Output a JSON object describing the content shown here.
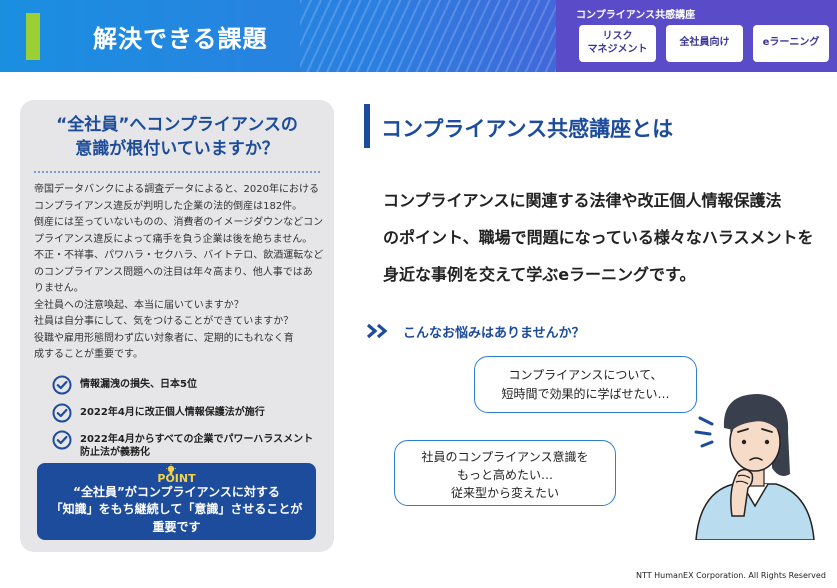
{
  "header": {
    "title": "解決できる課題",
    "course_title": "コンプライアンス共感講座",
    "tags": [
      "リスク\nマネジメント",
      "全社員向け",
      "eラーニング"
    ]
  },
  "left": {
    "heading": [
      "“全社員”へコンプライアンスの",
      "意識が根付いていますか？"
    ],
    "body": [
      "帝国データバンクによる調査データによると、2020年における",
      "コンプライアンス違反が判明した企業の法的倒産は182件。",
      "倒産には至っていないものの、消費者のイメージダウンなどコン",
      "プライアンス違反によって痛手を負う企業は後を絶ちません。",
      "不正・不祥事、パワハラ・セクハラ、バイトテロ、飲酒運転など",
      "のコンプライアンス問題への注目は年々高まり、他人事ではあ",
      "りません。",
      "全社員への注意喚起、本当に届いていますか？",
      "社員は自分事にして、気をつけることができていますか？",
      "役職や雇用形態問わず広い対象者に、定期的にもれなく育",
      "成することが重要です。"
    ],
    "checks": [
      "情報漏洩の損失、日本5位",
      "2022年4月に改正個人情報保護法が施行",
      "2022年4月からすべての企業でパワーハラスメント\n防止法が義務化"
    ],
    "point_label": "POINT",
    "point_text": [
      "“全社員”がコンプライアンスに対する",
      "「知識」をもち継続して「意識」させることが",
      "重要です"
    ]
  },
  "right": {
    "title": "コンプライアンス共感講座とは",
    "description": [
      "コンプライアンスに関連する法律や改正個人情報保護法",
      "のポイント、職場で問題になっている様々なハラスメントを",
      "身近な事例を交えて学ぶeラーニングです。"
    ],
    "worry_heading": "こんなお悩みはありませんか？",
    "bubble1": [
      "コンプライアンスについて、",
      "短時間で効果的に学ばせたい…"
    ],
    "bubble2": [
      "社員のコンプライアンス意識を",
      "もっと高めたい…",
      "従来型から変えたい"
    ]
  },
  "footer": {
    "copyright": "NTT HumanEX Corporation. All Rights Reserved"
  },
  "colors": {
    "brand_blue": "#1d4c9c",
    "header_purple": "#5a4cc8",
    "accent_green": "#9ccf35",
    "point_yellow": "#f4d24a"
  }
}
